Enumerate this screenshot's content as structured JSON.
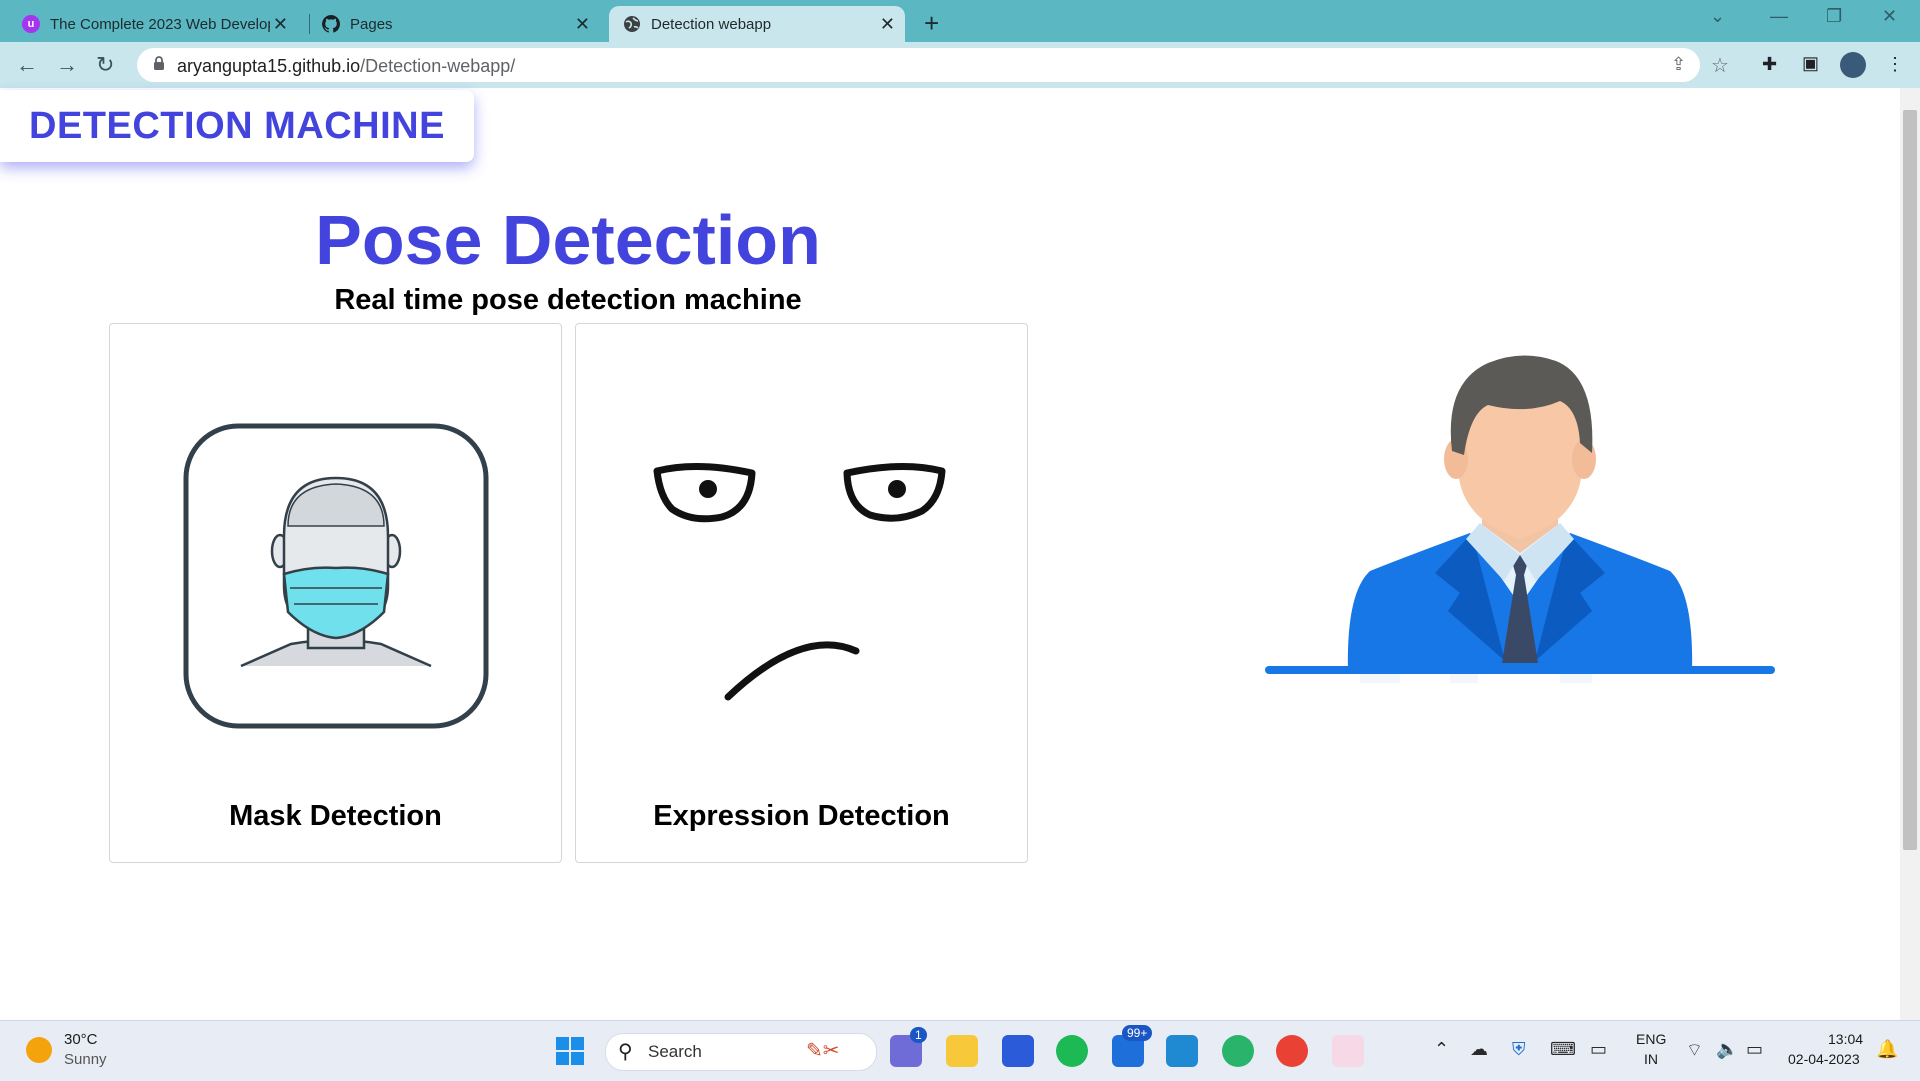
{
  "browser": {
    "tabs": [
      {
        "title": "The Complete 2023 Web Develop",
        "icon": "udemy-icon",
        "active": false
      },
      {
        "title": "Pages",
        "icon": "github-icon",
        "active": false
      },
      {
        "title": "Detection webapp",
        "icon": "globe-icon",
        "active": true
      }
    ],
    "url_host": "aryangupta15.github.io",
    "url_path": "/Detection-webapp/"
  },
  "page": {
    "brand": "DETECTION MACHINE",
    "title": "Pose Detection",
    "subtitle": "Real time pose detection machine",
    "cards": [
      {
        "label": "Mask Detection",
        "icon": "mask-face-icon"
      },
      {
        "label": "Expression Detection",
        "icon": "skeptical-face-icon"
      }
    ],
    "hero_image": "businessman-illustration"
  },
  "taskbar": {
    "weather_temp": "30°C",
    "weather_desc": "Sunny",
    "search_label": "Search",
    "teams_badge": "1",
    "mail_badge": "99+",
    "lang_line1": "ENG",
    "lang_line2": "IN",
    "time": "13:04",
    "date": "02-04-2023"
  },
  "colors": {
    "accent": "#4343dd",
    "tab_strip": "#5bb7c2",
    "toolbar": "#c8e6eb",
    "suit_blue": "#1877e6"
  }
}
